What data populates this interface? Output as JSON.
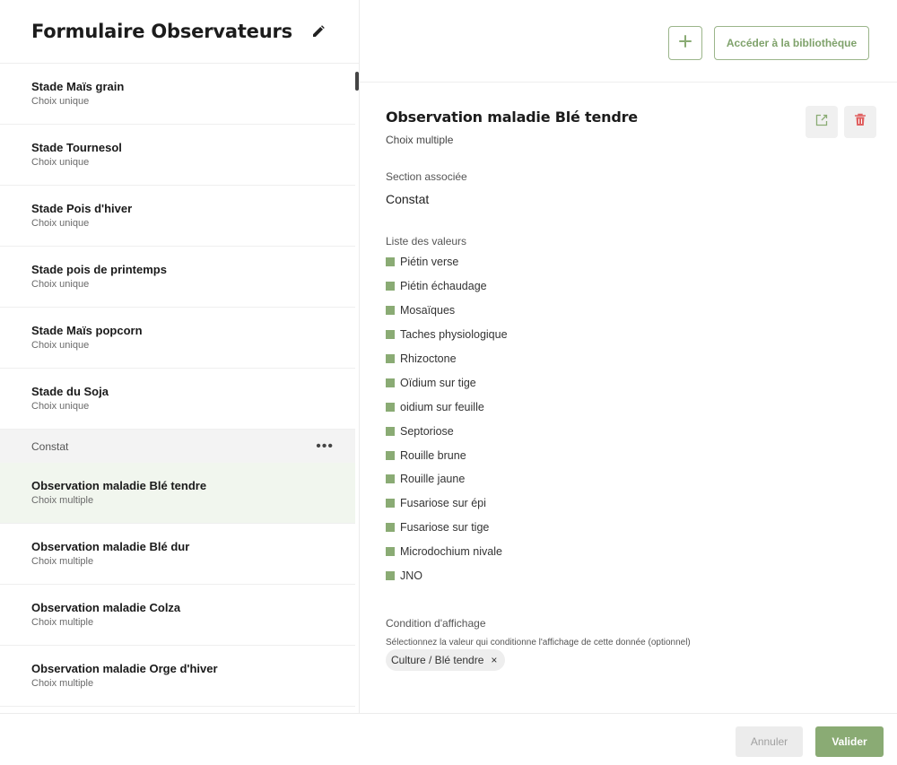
{
  "left": {
    "title": "Formulaire Observateurs",
    "items_top": [
      {
        "name": "Stade Maïs grain",
        "type": "Choix unique"
      },
      {
        "name": "Stade Tournesol",
        "type": "Choix unique"
      },
      {
        "name": "Stade Pois d'hiver",
        "type": "Choix unique"
      },
      {
        "name": "Stade pois de printemps",
        "type": "Choix unique"
      },
      {
        "name": "Stade Maïs popcorn",
        "type": "Choix unique"
      },
      {
        "name": "Stade du Soja",
        "type": "Choix unique"
      }
    ],
    "section": {
      "label": "Constat",
      "menu_icon": "more-horizontal-icon"
    },
    "items_bottom": [
      {
        "name": "Observation maladie Blé tendre",
        "type": "Choix multiple",
        "selected": true
      },
      {
        "name": "Observation maladie Blé dur",
        "type": "Choix multiple"
      },
      {
        "name": "Observation maladie Colza",
        "type": "Choix multiple"
      },
      {
        "name": "Observation maladie Orge d'hiver",
        "type": "Choix multiple"
      }
    ]
  },
  "toolbar": {
    "add_icon": "plus-icon",
    "library_label": "Accéder à la bibliothèque"
  },
  "detail": {
    "title": "Observation maladie Blé tendre",
    "type": "Choix multiple",
    "section_label": "Section associée",
    "section_value": "Constat",
    "values_label": "Liste des valeurs",
    "values": [
      "Piétin verse",
      "Piétin échaudage",
      "Mosaïques",
      "Taches physiologique",
      "Rhizoctone",
      "Oïdium sur tige",
      "oidium sur feuille",
      "Septoriose",
      "Rouille brune",
      "Rouille jaune",
      "Fusariose sur épi",
      "Fusariose sur tige",
      "Microdochium nivale",
      "JNO"
    ],
    "condition_label": "Condition d'affichage",
    "condition_help": "Sélectionnez la valeur qui conditionne l'affichage de cette donnée (optionnel)",
    "condition_chip": "Culture / Blé tendre",
    "chip_remove": "×"
  },
  "footer": {
    "cancel_label": "Annuler",
    "validate_label": "Valider"
  },
  "colors": {
    "accent": "#8aab74",
    "accent_text": "#7fa26b",
    "delete": "#e06060",
    "selected_bg": "#f1f6ee"
  }
}
